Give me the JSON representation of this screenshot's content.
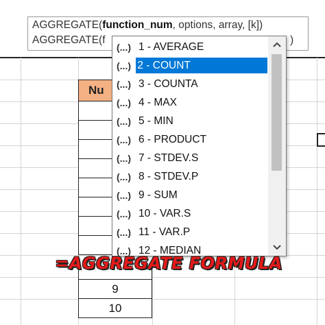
{
  "tooltip": {
    "line1_prefix": "AGGREGATE(",
    "line1_bold": "function_num",
    "line1_suffix": ", options, array, [k])",
    "line2_prefix": "AGGREGATE(f",
    "line2_tail": ")"
  },
  "column": {
    "header": "Nu",
    "visible_values": [
      "9",
      "10"
    ]
  },
  "dropdown": {
    "selected_index": 1,
    "items": [
      {
        "icon": "(...)",
        "label": "1 - AVERAGE"
      },
      {
        "icon": "(...)",
        "label": "2 - COUNT"
      },
      {
        "icon": "(...)",
        "label": "3 - COUNTA"
      },
      {
        "icon": "(...)",
        "label": "4 - MAX"
      },
      {
        "icon": "(...)",
        "label": "5 - MIN"
      },
      {
        "icon": "(...)",
        "label": "6 - PRODUCT"
      },
      {
        "icon": "(...)",
        "label": "7 - STDEV.S"
      },
      {
        "icon": "(...)",
        "label": "8 - STDEV.P"
      },
      {
        "icon": "(...)",
        "label": "9 - SUM"
      },
      {
        "icon": "(...)",
        "label": "10 - VAR.S"
      },
      {
        "icon": "(...)",
        "label": "11 - VAR.P"
      },
      {
        "icon": "(...)",
        "label": "12 - MEDIAN"
      }
    ],
    "scroll_up_icon": "chevron-up-icon",
    "scroll_down_icon": "chevron-down-icon"
  },
  "caption": "=AGGREGATE FORMULA",
  "colors": {
    "header_fill": "#f4b183",
    "selection": "#0078d7",
    "caption": "#e41a1a"
  }
}
